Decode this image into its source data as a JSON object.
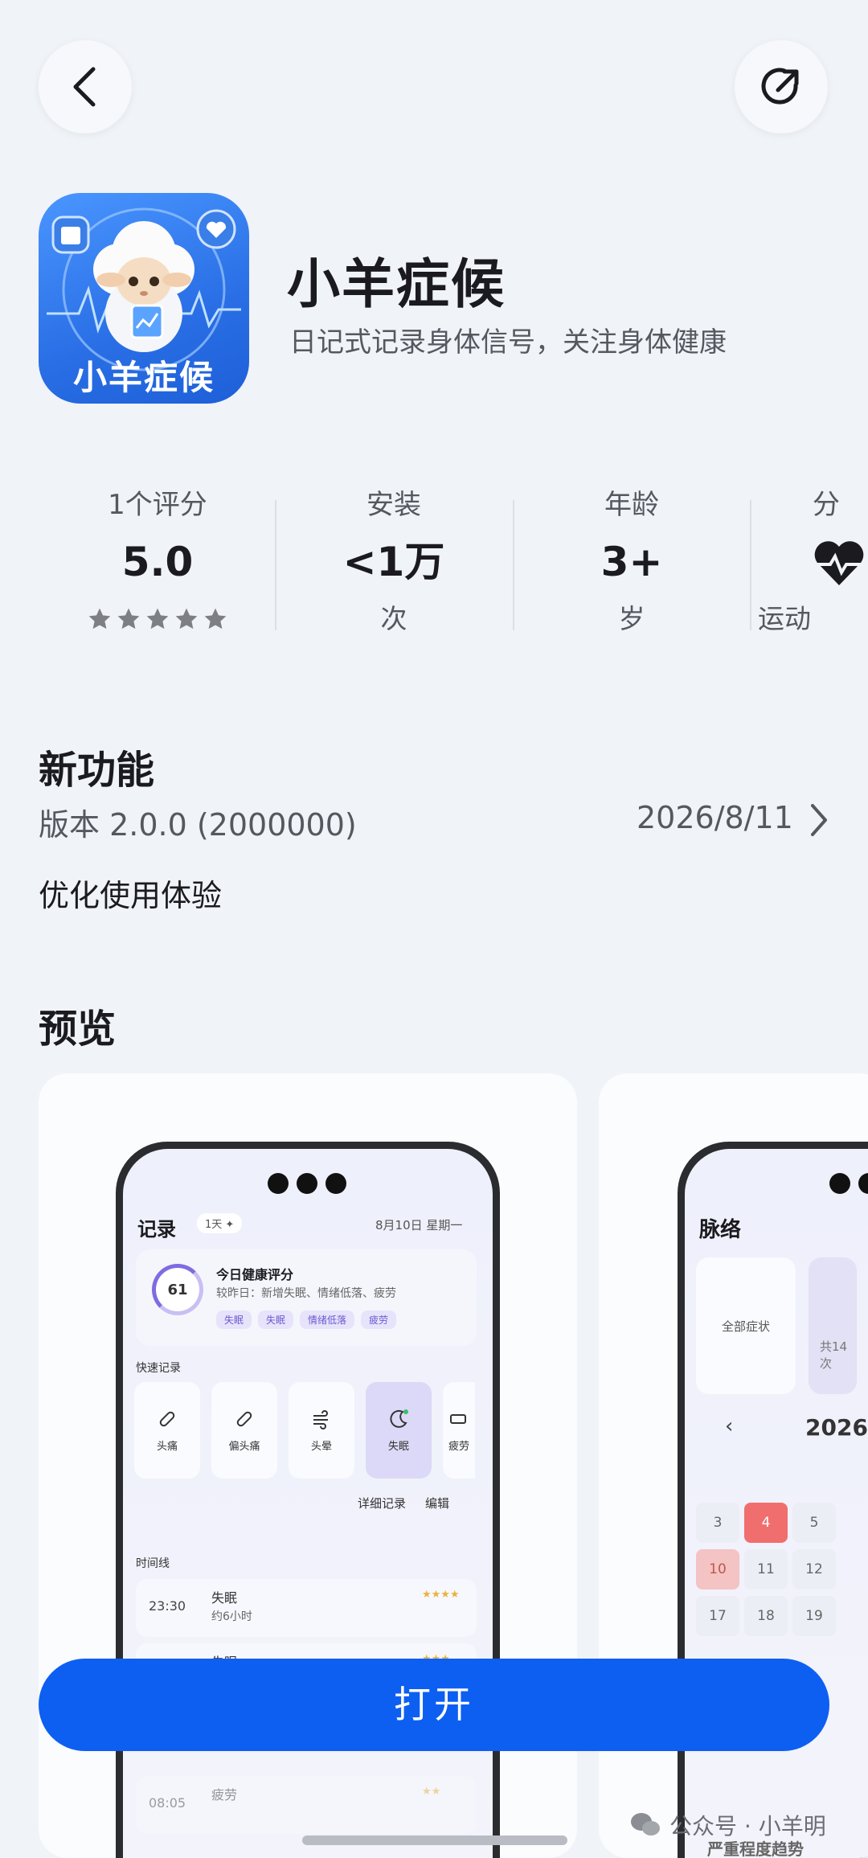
{
  "app": {
    "name": "小羊症候",
    "icon_text": "小羊症候",
    "subtitle": "日记式记录身体信号，关注身体健康"
  },
  "stats": [
    {
      "label": "1个评分",
      "value": "5.0",
      "rating": 5
    },
    {
      "label": "安装",
      "value": "<1万",
      "sub": "次"
    },
    {
      "label": "年龄",
      "value": "3+",
      "sub": "岁"
    },
    {
      "label": "分",
      "sub": "运动",
      "icon": "heartbeat-icon"
    }
  ],
  "whats_new": {
    "title": "新功能",
    "version": "版本 2.0.0 (2000000)",
    "date": "2026/8/11",
    "notes": "优化使用体验"
  },
  "preview": {
    "title": "预览",
    "screen1": {
      "title": "记录",
      "day_pill": "1天 ✦",
      "date": "8月10日 星期一",
      "score": "61",
      "score_title": "今日健康评分",
      "score_desc": "较昨日：新增失眠、情绪低落、疲劳",
      "tags": [
        "失眠",
        "失眠",
        "情绪低落",
        "疲劳"
      ],
      "quick_label": "快速记录",
      "quick_items": [
        "头痛",
        "偏头痛",
        "头晕",
        "失眠",
        "疲劳"
      ],
      "links": [
        "详细记录",
        "编辑"
      ],
      "timeline_label": "时间线",
      "timeline": [
        {
          "time": "23:30",
          "name": "失眠",
          "sub": "约6小时",
          "stars": "★★★★"
        },
        {
          "time": "",
          "name": "失眠",
          "sub": "",
          "stars": "★★★"
        },
        {
          "time": "08:05",
          "name": "疲劳",
          "sub": "",
          "stars": "★★"
        }
      ]
    },
    "screen2": {
      "title": "脉络",
      "all_symptoms": "全部症状",
      "side_text": "共14次",
      "year": "2026",
      "calendar_row1": [
        "3",
        "4",
        "5"
      ],
      "calendar_row2": [
        "10",
        "11",
        "12"
      ],
      "calendar_row3": [
        "17",
        "18",
        "19"
      ],
      "trend": "严重程度趋势"
    }
  },
  "open_button": "打开",
  "watermark": "公众号 · 小羊明",
  "colors": {
    "accent": "#0d5ff2",
    "background": "#f0f3f8",
    "star": "#7d7f85"
  }
}
